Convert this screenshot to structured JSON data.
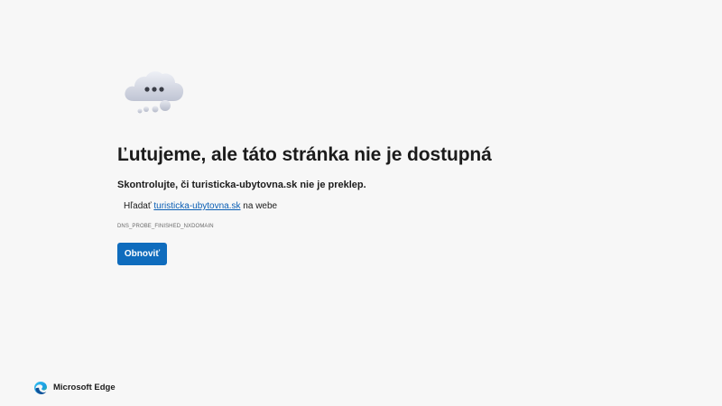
{
  "error": {
    "illustration_icon": "cloud-thinking-icon",
    "title": "Ľutujeme, ale táto stránka nie je dostupná",
    "check_message": "Skontrolujte, či turisticka-ubytovna.sk nie je preklep.",
    "search_prefix": "Hľadať",
    "search_link": "turisticka-ubytovna.sk",
    "search_suffix": "na webe",
    "error_code": "DNS_PROBE_FINISHED_NXDOMAIN",
    "reload_label": "Obnoviť"
  },
  "footer": {
    "brand_icon": "microsoft-edge-icon",
    "brand_name": "Microsoft Edge"
  },
  "colors": {
    "background": "#f7f7f7",
    "button": "#0f6cbd",
    "link": "#0a5eb4"
  }
}
